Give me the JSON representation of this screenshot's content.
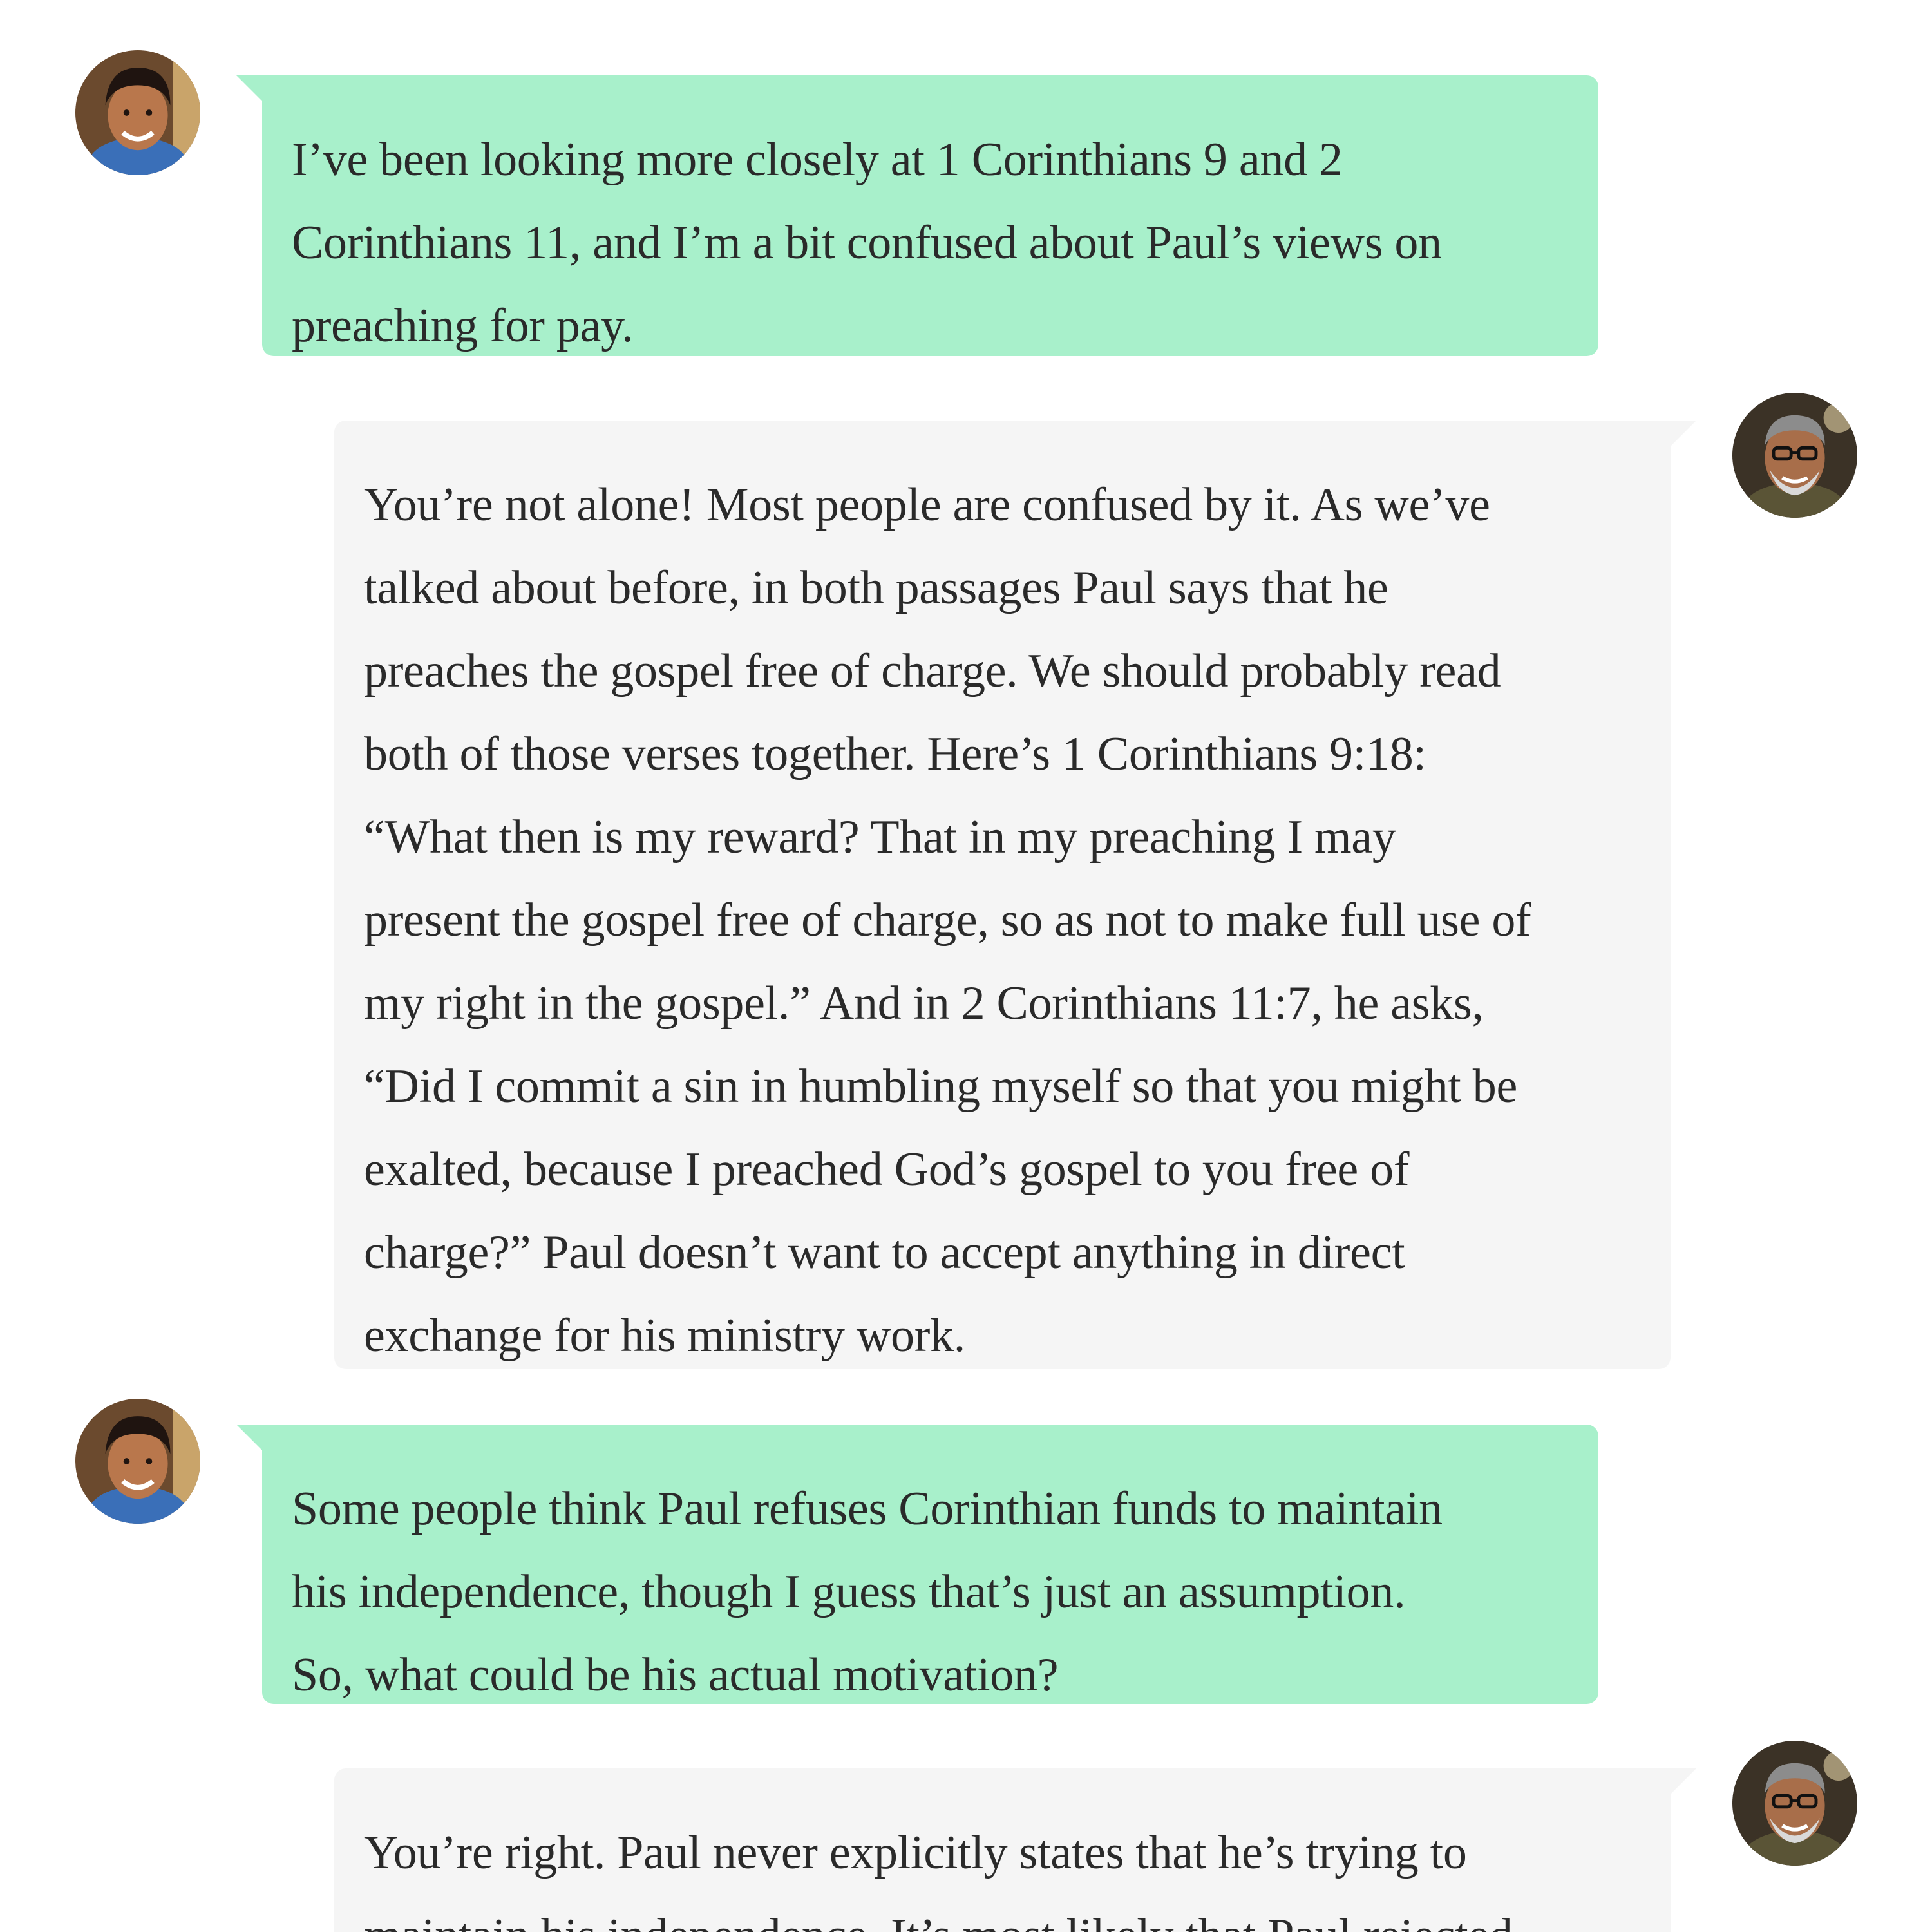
{
  "messages": [
    {
      "role": "user",
      "lines": [
        "I’ve been looking more closely at 1 Corinthians 9 and 2",
        "Corinthians 11, and I’m a bit confused about Paul’s views on",
        "preaching for pay."
      ]
    },
    {
      "role": "tutor",
      "lines": [
        "You’re not alone! Most people are confused by it. As we’ve",
        "talked about before, in both passages Paul says that he",
        "preaches the gospel free of charge. We should probably read",
        "both of those verses together. Here’s 1 Corinthians 9:18:",
        "“What then is my reward? That in my preaching I may",
        "present the gospel free of charge, so as not to make full use of",
        "my right in the gospel.” And in 2 Corinthians 11:7, he asks,",
        "“Did I commit a sin in humbling myself so that you might be",
        "exalted, because I preached God’s gospel to you free of",
        "charge?” Paul doesn’t want to accept anything in direct",
        "exchange for his ministry work."
      ]
    },
    {
      "role": "user",
      "lines": [
        "Some people think Paul refuses Corinthian funds to maintain",
        "his independence, though I guess that’s just an assumption.",
        "So, what could be his actual motivation?"
      ]
    },
    {
      "role": "tutor",
      "lines": [
        "You’re right. Paul never explicitly states that he’s trying to",
        "maintain his independence. It’s most likely that Paul rejected"
      ]
    }
  ],
  "colors": {
    "user_bubble": "#a8f0cb",
    "tutor_bubble": "#f5f5f5",
    "text": "#2a2a2a",
    "background": "#ffffff"
  },
  "avatars": {
    "user": "young-man-avatar-icon",
    "tutor": "older-man-glasses-avatar-icon"
  }
}
